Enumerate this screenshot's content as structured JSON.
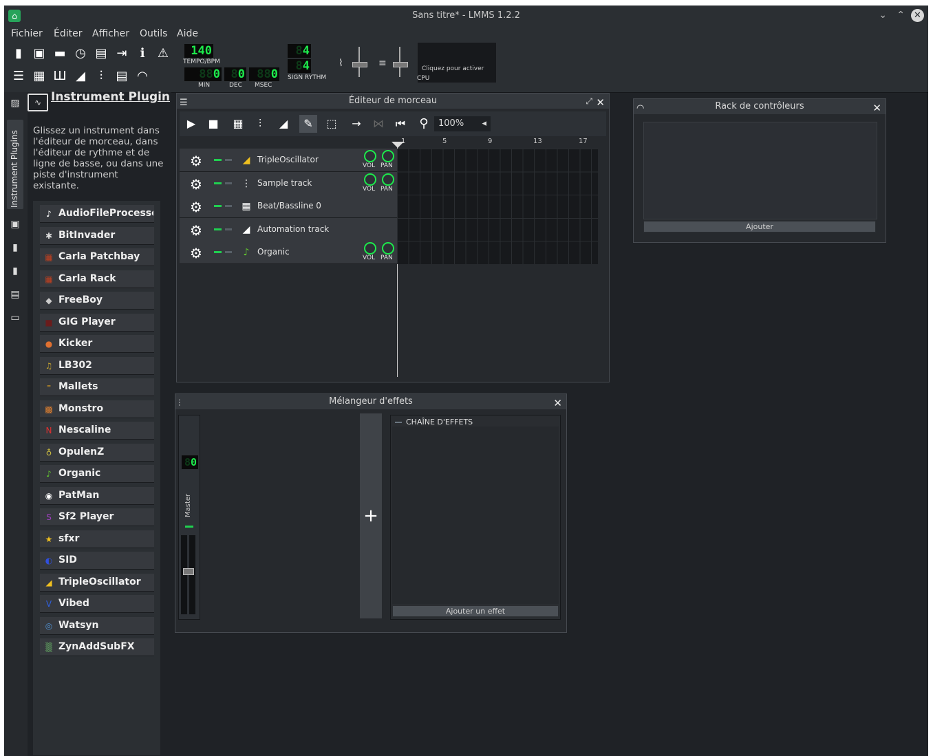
{
  "window": {
    "title": "Sans titre* - LMMS 1.2.2"
  },
  "menu": [
    "Fichier",
    "Éditer",
    "Afficher",
    "Outils",
    "Aide"
  ],
  "toolbar": {
    "tempo": "140",
    "tempo_label": "TEMPO/BPM",
    "time_min": "0",
    "time_min_label": "MIN",
    "time_dec": "0",
    "time_dec_label": "DEC",
    "time_msec": "0",
    "time_msec_label": "MSEC",
    "sig_num": "4",
    "sig_den": "4",
    "sig_label": "SIGN RYTHM",
    "cpu_hint": "Cliquez pour activer",
    "cpu_label": "CPU"
  },
  "sidebar": {
    "tab_label": "Instrument Plugins"
  },
  "instrument_panel": {
    "title": "Instrument Plugin",
    "description": "Glissez un instrument dans l'éditeur de morceau, dans l'éditeur de rythme et de ligne de basse, ou dans une piste d'instrument existante.",
    "plugins": [
      {
        "label": "AudioFileProcessor",
        "icon": "♪",
        "color": "#ffffff"
      },
      {
        "label": "BitInvader",
        "icon": "✱",
        "color": "#dddddd"
      },
      {
        "label": "Carla Patchbay",
        "icon": "▦",
        "color": "#c04020"
      },
      {
        "label": "Carla Rack",
        "icon": "▦",
        "color": "#c04020"
      },
      {
        "label": "FreeBoy",
        "icon": "◆",
        "color": "#cccccc"
      },
      {
        "label": "GIG Player",
        "icon": "■",
        "color": "#6a1c1c"
      },
      {
        "label": "Kicker",
        "icon": "●",
        "color": "#e07030"
      },
      {
        "label": "LB302",
        "icon": "♫",
        "color": "#c0a030"
      },
      {
        "label": "Mallets",
        "icon": "⁼",
        "color": "#e0a020"
      },
      {
        "label": "Monstro",
        "icon": "▩",
        "color": "#e08030"
      },
      {
        "label": "Nescaline",
        "icon": "N",
        "color": "#e03030"
      },
      {
        "label": "OpulenZ",
        "icon": "♁",
        "color": "#d0c040"
      },
      {
        "label": "Organic",
        "icon": "♪",
        "color": "#60c030"
      },
      {
        "label": "PatMan",
        "icon": "◉",
        "color": "#ffffff"
      },
      {
        "label": "Sf2 Player",
        "icon": "S",
        "color": "#a040c0"
      },
      {
        "label": "sfxr",
        "icon": "★",
        "color": "#f0c020"
      },
      {
        "label": "SID",
        "icon": "◐",
        "color": "#3050e0"
      },
      {
        "label": "TripleOscillator",
        "icon": "◢",
        "color": "#f0c020"
      },
      {
        "label": "Vibed",
        "icon": "V",
        "color": "#3060e0"
      },
      {
        "label": "Watsyn",
        "icon": "◎",
        "color": "#5090d0"
      },
      {
        "label": "ZynAddSubFX",
        "icon": "▒",
        "color": "#60a060"
      }
    ]
  },
  "song_editor": {
    "title": "Éditeur de morceau",
    "zoom": "100%",
    "ruler": [
      "1",
      "5",
      "9",
      "13",
      "17"
    ],
    "tracks": [
      {
        "name": "TripleOscillator",
        "icon": "◢",
        "icon_color": "#f0c020",
        "knobs": true
      },
      {
        "name": "Sample track",
        "icon": "⋮",
        "icon_color": "#ffffff",
        "knobs": true
      },
      {
        "name": "Beat/Bassline 0",
        "icon": "▦",
        "icon_color": "#ffffff",
        "knobs": false
      },
      {
        "name": "Automation track",
        "icon": "◢",
        "icon_color": "#ffffff",
        "knobs": false
      },
      {
        "name": "Organic",
        "icon": "♪",
        "icon_color": "#60c030",
        "knobs": true
      }
    ],
    "vol_label": "VOL",
    "pan_label": "PAN"
  },
  "controller_rack": {
    "title": "Rack de contrôleurs",
    "add_button": "Ajouter"
  },
  "fx_mixer": {
    "title": "Mélangeur d'effets",
    "master_label": "Master",
    "master_value": "0",
    "add_channel": "+",
    "chain_title": "CHAÎNE D'EFFETS",
    "add_effect": "Ajouter un effet"
  }
}
